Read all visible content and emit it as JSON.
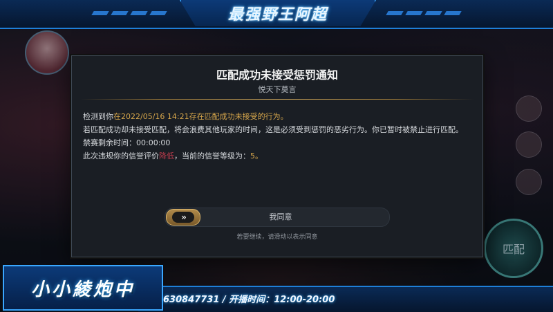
{
  "stream_overlay": {
    "top_title": "最强野王阿超",
    "bottom_name": "小小綾炮中",
    "bottom_info": "630847731 / 开播时间：12:00-20:00"
  },
  "modal": {
    "title": "匹配成功未接受惩罚通知",
    "subtitle": "悦天下莫言",
    "line1_prefix": "检测到你",
    "line1_highlight": "在2022/05/16 14:21存在匹配成功未接受的行为。",
    "line2": "若匹配成功却未接受匹配，将会浪费其他玩家的时间，这是必须受到惩罚的恶劣行为。你已暂时被禁止进行匹配。",
    "line3": "禁赛剩余时间：00:00:00",
    "line4_prefix": "此次违规你的信誉评价",
    "line4_red": "降低",
    "line4_mid": "，当前的信誉等级为：",
    "line4_value": "5。",
    "slider_label": "我同意",
    "slider_knob": "»",
    "slider_hint": "若要继续，请滑动以表示同意"
  },
  "game_bg": {
    "match_button_label": "匹配"
  },
  "colors": {
    "accent_gold": "#d6a64b",
    "accent_red": "#b53a4a",
    "overlay_blue": "#1e7fd8"
  }
}
